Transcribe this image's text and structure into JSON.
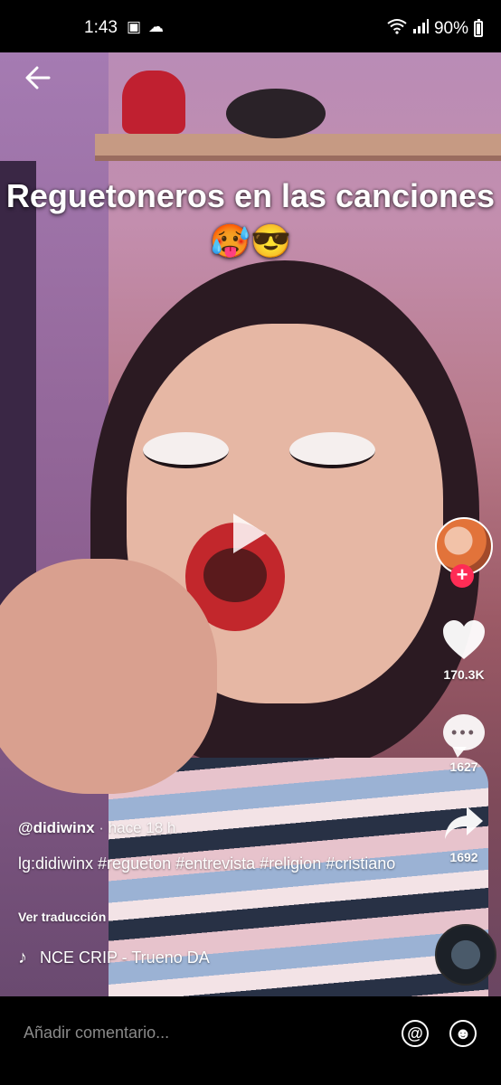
{
  "status_bar": {
    "time": "1:43",
    "left_icons": [
      "image-icon",
      "weather-icon"
    ],
    "right_icons": [
      "wifi-icon",
      "signal-icon"
    ],
    "battery": "90%"
  },
  "video": {
    "caption": "Reguetoneros en las canciones 🥵😎",
    "paused": true
  },
  "actions": {
    "likes": "170.3K",
    "comments": "1627",
    "shares": "1692"
  },
  "post": {
    "username": "@didiwinx",
    "time": " · hace 18 h",
    "description": "lg:didiwinx #regueton #entrevista #religion #cristiano",
    "translate": "Ver traducción",
    "music": "NCE CRIP - Trueno     DA"
  },
  "bottom_bar": {
    "comment_placeholder": "Añadir comentario...",
    "mention_icon": "@",
    "emoji_icon": "☻"
  },
  "colors": {
    "follow_accent": "#fe2c55",
    "bottom_bar": "#000000"
  }
}
